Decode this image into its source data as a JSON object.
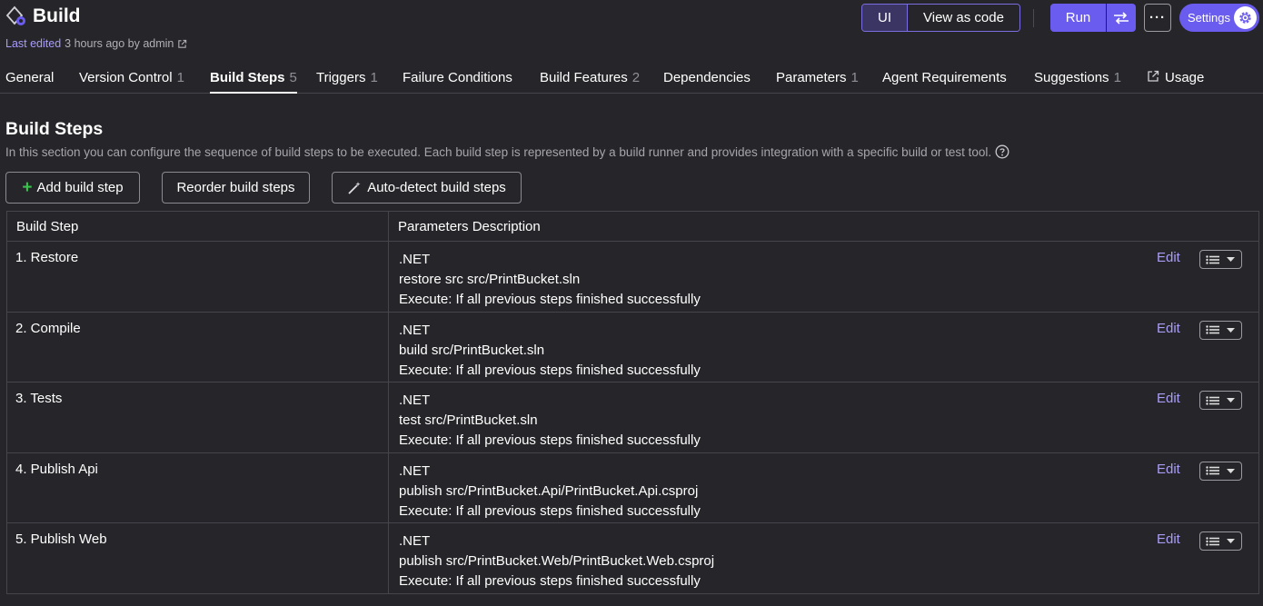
{
  "header": {
    "title": "Build",
    "last_edited_label": "Last edited",
    "last_edited_rest": "3 hours ago by admin",
    "toggle_ui": "UI",
    "toggle_code": "View as code",
    "run_label": "Run",
    "more_label": "···",
    "settings_label": "Settings"
  },
  "tabs": [
    {
      "label": "General",
      "count": ""
    },
    {
      "label": "Version Control",
      "count": "1"
    },
    {
      "label": "Build Steps",
      "count": "5"
    },
    {
      "label": "Triggers",
      "count": "1"
    },
    {
      "label": "Failure Conditions",
      "count": ""
    },
    {
      "label": "Build Features",
      "count": "2"
    },
    {
      "label": "Dependencies",
      "count": ""
    },
    {
      "label": "Parameters",
      "count": "1"
    },
    {
      "label": "Agent Requirements",
      "count": ""
    },
    {
      "label": "Suggestions",
      "count": "1"
    },
    {
      "label": "Usage",
      "count": ""
    }
  ],
  "section": {
    "title": "Build Steps",
    "description": "In this section you can configure the sequence of build steps to be executed. Each build step is represented by a build runner and provides integration with a specific build or test tool."
  },
  "actions": {
    "add": "Add build step",
    "reorder": "Reorder build steps",
    "autodetect": "Auto-detect build steps"
  },
  "table": {
    "col1": "Build Step",
    "col2": "Parameters Description",
    "edit_label": "Edit",
    "rows": [
      {
        "name": "1. Restore",
        "runner": ".NET",
        "command": "restore src src/PrintBucket.sln",
        "execute": "Execute: If all previous steps finished successfully"
      },
      {
        "name": "2. Compile",
        "runner": ".NET",
        "command": "build src/PrintBucket.sln",
        "execute": "Execute: If all previous steps finished successfully"
      },
      {
        "name": "3. Tests",
        "runner": ".NET",
        "command": "test src/PrintBucket.sln",
        "execute": "Execute: If all previous steps finished successfully"
      },
      {
        "name": "4. Publish Api",
        "runner": ".NET",
        "command": "publish src/PrintBucket.Api/PrintBucket.Api.csproj",
        "execute": "Execute: If all previous steps finished successfully"
      },
      {
        "name": "5. Publish Web",
        "runner": ".NET",
        "command": "publish src/PrintBucket.Web/PrintBucket.Web.csproj",
        "execute": "Execute: If all previous steps finished successfully"
      }
    ]
  },
  "colors": {
    "background": "#26262a",
    "accent": "#6b5cf0",
    "link": "#a89cf7",
    "plus": "#37c24b"
  },
  "icons": [
    "build-config-icon",
    "external-link-icon",
    "run-options-icon",
    "gear-icon",
    "help-icon",
    "plus-icon",
    "magic-wand-icon",
    "list-icon",
    "chevron-down-icon"
  ]
}
